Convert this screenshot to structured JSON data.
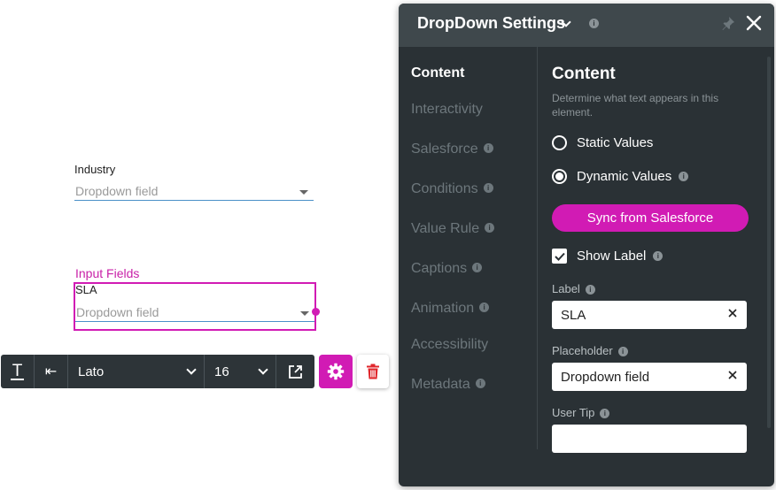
{
  "canvas": {
    "industry": {
      "label": "Industry",
      "placeholder": "Dropdown field"
    },
    "input_fields_group": {
      "label": "Input Fields"
    },
    "sla": {
      "label": "SLA",
      "placeholder": "Dropdown field"
    }
  },
  "toolbar": {
    "text_icon": "T",
    "indent_icon": "⇤",
    "font": "Lato",
    "size": "16"
  },
  "panel": {
    "title": "DropDown Settings",
    "info": "i",
    "nav": [
      {
        "label": "Content",
        "active": true,
        "info": ""
      },
      {
        "label": "Interactivity",
        "active": false,
        "info": ""
      },
      {
        "label": "Salesforce",
        "active": false,
        "info": "i"
      },
      {
        "label": "Conditions",
        "active": false,
        "info": "i"
      },
      {
        "label": "Value Rule",
        "active": false,
        "info": "i"
      },
      {
        "label": "Captions",
        "active": false,
        "info": "i"
      },
      {
        "label": "Animation",
        "active": false,
        "info": "i"
      },
      {
        "label": "Accessibility",
        "active": false,
        "info": ""
      },
      {
        "label": "Metadata",
        "active": false,
        "info": "i"
      }
    ],
    "content": {
      "title": "Content",
      "description": "Determine what text appears in this element.",
      "static_values": "Static Values",
      "dynamic_values": "Dynamic Values",
      "selected_source": "Dynamic Values",
      "sync_button": "Sync from Salesforce",
      "show_label": "Show Label",
      "show_label_checked": true,
      "label_caption": "Label",
      "label_value": "SLA",
      "placeholder_caption": "Placeholder",
      "placeholder_value": "Dropdown field",
      "user_tip_caption": "User Tip",
      "user_tip_value": ""
    }
  },
  "colors": {
    "accent": "#d11bb4",
    "panel_bg": "#2a3135",
    "panel_header": "#3f484c",
    "toolbar_bg": "#2d3438",
    "field_underline": "#4a90c8"
  }
}
